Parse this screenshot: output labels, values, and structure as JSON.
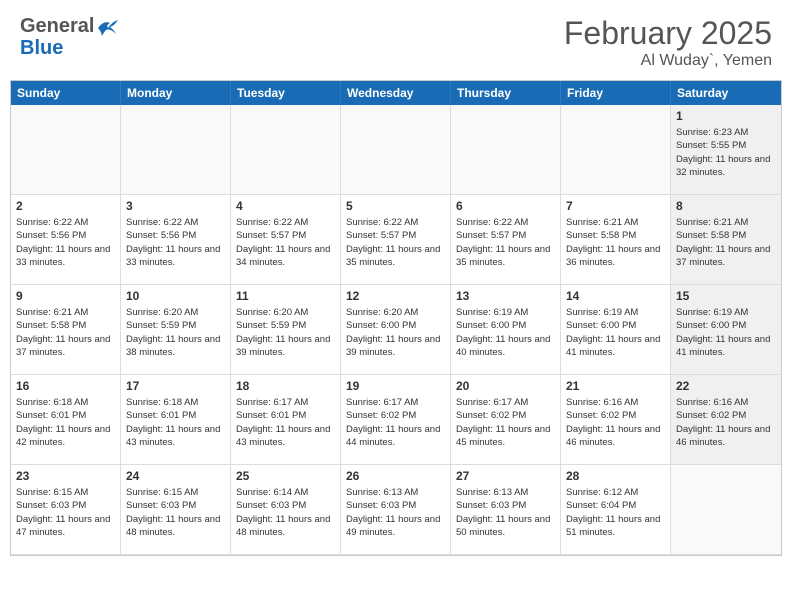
{
  "header": {
    "logo_general": "General",
    "logo_blue": "Blue",
    "title": "February 2025",
    "location": "Al Wuday`, Yemen"
  },
  "weekdays": [
    "Sunday",
    "Monday",
    "Tuesday",
    "Wednesday",
    "Thursday",
    "Friday",
    "Saturday"
  ],
  "weeks": [
    [
      {
        "day": "",
        "info": ""
      },
      {
        "day": "",
        "info": ""
      },
      {
        "day": "",
        "info": ""
      },
      {
        "day": "",
        "info": ""
      },
      {
        "day": "",
        "info": ""
      },
      {
        "day": "",
        "info": ""
      },
      {
        "day": "1",
        "info": "Sunrise: 6:23 AM\nSunset: 5:55 PM\nDaylight: 11 hours and 32 minutes."
      }
    ],
    [
      {
        "day": "2",
        "info": "Sunrise: 6:22 AM\nSunset: 5:56 PM\nDaylight: 11 hours and 33 minutes."
      },
      {
        "day": "3",
        "info": "Sunrise: 6:22 AM\nSunset: 5:56 PM\nDaylight: 11 hours and 33 minutes."
      },
      {
        "day": "4",
        "info": "Sunrise: 6:22 AM\nSunset: 5:57 PM\nDaylight: 11 hours and 34 minutes."
      },
      {
        "day": "5",
        "info": "Sunrise: 6:22 AM\nSunset: 5:57 PM\nDaylight: 11 hours and 35 minutes."
      },
      {
        "day": "6",
        "info": "Sunrise: 6:22 AM\nSunset: 5:57 PM\nDaylight: 11 hours and 35 minutes."
      },
      {
        "day": "7",
        "info": "Sunrise: 6:21 AM\nSunset: 5:58 PM\nDaylight: 11 hours and 36 minutes."
      },
      {
        "day": "8",
        "info": "Sunrise: 6:21 AM\nSunset: 5:58 PM\nDaylight: 11 hours and 37 minutes."
      }
    ],
    [
      {
        "day": "9",
        "info": "Sunrise: 6:21 AM\nSunset: 5:58 PM\nDaylight: 11 hours and 37 minutes."
      },
      {
        "day": "10",
        "info": "Sunrise: 6:20 AM\nSunset: 5:59 PM\nDaylight: 11 hours and 38 minutes."
      },
      {
        "day": "11",
        "info": "Sunrise: 6:20 AM\nSunset: 5:59 PM\nDaylight: 11 hours and 39 minutes."
      },
      {
        "day": "12",
        "info": "Sunrise: 6:20 AM\nSunset: 6:00 PM\nDaylight: 11 hours and 39 minutes."
      },
      {
        "day": "13",
        "info": "Sunrise: 6:19 AM\nSunset: 6:00 PM\nDaylight: 11 hours and 40 minutes."
      },
      {
        "day": "14",
        "info": "Sunrise: 6:19 AM\nSunset: 6:00 PM\nDaylight: 11 hours and 41 minutes."
      },
      {
        "day": "15",
        "info": "Sunrise: 6:19 AM\nSunset: 6:00 PM\nDaylight: 11 hours and 41 minutes."
      }
    ],
    [
      {
        "day": "16",
        "info": "Sunrise: 6:18 AM\nSunset: 6:01 PM\nDaylight: 11 hours and 42 minutes."
      },
      {
        "day": "17",
        "info": "Sunrise: 6:18 AM\nSunset: 6:01 PM\nDaylight: 11 hours and 43 minutes."
      },
      {
        "day": "18",
        "info": "Sunrise: 6:17 AM\nSunset: 6:01 PM\nDaylight: 11 hours and 43 minutes."
      },
      {
        "day": "19",
        "info": "Sunrise: 6:17 AM\nSunset: 6:02 PM\nDaylight: 11 hours and 44 minutes."
      },
      {
        "day": "20",
        "info": "Sunrise: 6:17 AM\nSunset: 6:02 PM\nDaylight: 11 hours and 45 minutes."
      },
      {
        "day": "21",
        "info": "Sunrise: 6:16 AM\nSunset: 6:02 PM\nDaylight: 11 hours and 46 minutes."
      },
      {
        "day": "22",
        "info": "Sunrise: 6:16 AM\nSunset: 6:02 PM\nDaylight: 11 hours and 46 minutes."
      }
    ],
    [
      {
        "day": "23",
        "info": "Sunrise: 6:15 AM\nSunset: 6:03 PM\nDaylight: 11 hours and 47 minutes."
      },
      {
        "day": "24",
        "info": "Sunrise: 6:15 AM\nSunset: 6:03 PM\nDaylight: 11 hours and 48 minutes."
      },
      {
        "day": "25",
        "info": "Sunrise: 6:14 AM\nSunset: 6:03 PM\nDaylight: 11 hours and 48 minutes."
      },
      {
        "day": "26",
        "info": "Sunrise: 6:13 AM\nSunset: 6:03 PM\nDaylight: 11 hours and 49 minutes."
      },
      {
        "day": "27",
        "info": "Sunrise: 6:13 AM\nSunset: 6:03 PM\nDaylight: 11 hours and 50 minutes."
      },
      {
        "day": "28",
        "info": "Sunrise: 6:12 AM\nSunset: 6:04 PM\nDaylight: 11 hours and 51 minutes."
      },
      {
        "day": "",
        "info": ""
      }
    ]
  ]
}
